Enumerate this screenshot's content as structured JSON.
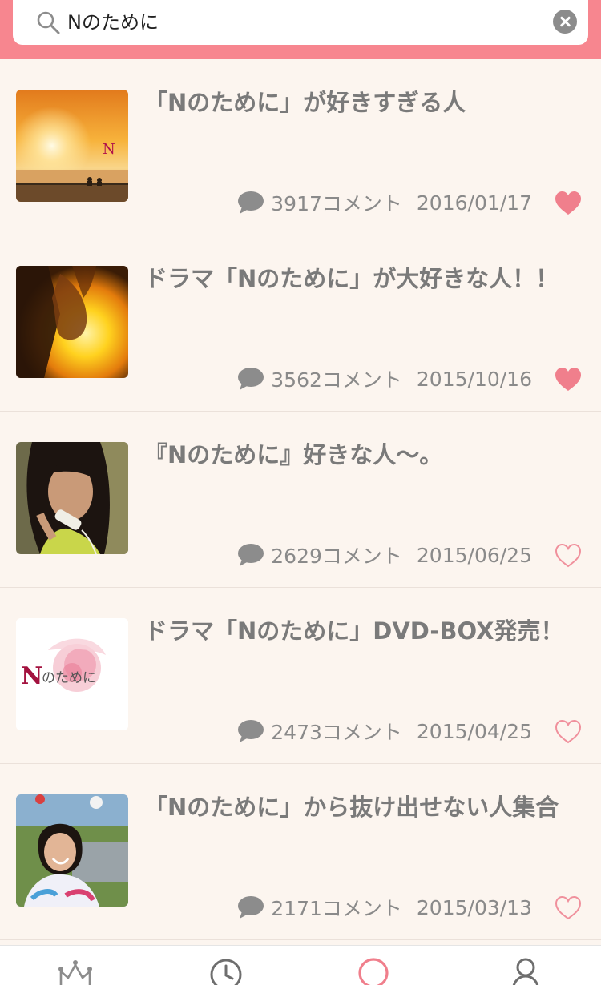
{
  "search": {
    "value": "Nのために",
    "placeholder": ""
  },
  "colors": {
    "accent": "#f7868f",
    "heart_filled": "#f07f8c",
    "heart_outline": "#f0909c",
    "background": "#fcf5ef"
  },
  "results": [
    {
      "title": "「Nのために」が好きすぎる人",
      "comments": "3917コメント",
      "date": "2016/01/17",
      "favorited": true,
      "thumb": "sunset-beach"
    },
    {
      "title": "ドラマ「Nのために」が大好きな人！！",
      "comments": "3562コメント",
      "date": "2015/10/16",
      "favorited": true,
      "thumb": "hands-light"
    },
    {
      "title": "『Nのために』好きな人〜。",
      "comments": "2629コメント",
      "date": "2015/06/25",
      "favorited": false,
      "thumb": "woman-phone"
    },
    {
      "title": "ドラマ「Nのために」DVD-BOX発売！",
      "comments": "2473コメント",
      "date": "2015/04/25",
      "favorited": false,
      "thumb": "rose-logo"
    },
    {
      "title": "「Nのために」から抜け出せない人集合",
      "comments": "2171コメント",
      "date": "2015/03/13",
      "favorited": false,
      "thumb": "smiling-girl"
    }
  ],
  "thumb_text": {
    "rose_logo": "Nのために"
  },
  "tabbar": {
    "items": [
      {
        "icon": "crown-icon",
        "active": false
      },
      {
        "icon": "clock-icon",
        "active": false
      },
      {
        "icon": "search-icon",
        "active": true
      },
      {
        "icon": "user-icon",
        "active": false
      }
    ]
  }
}
